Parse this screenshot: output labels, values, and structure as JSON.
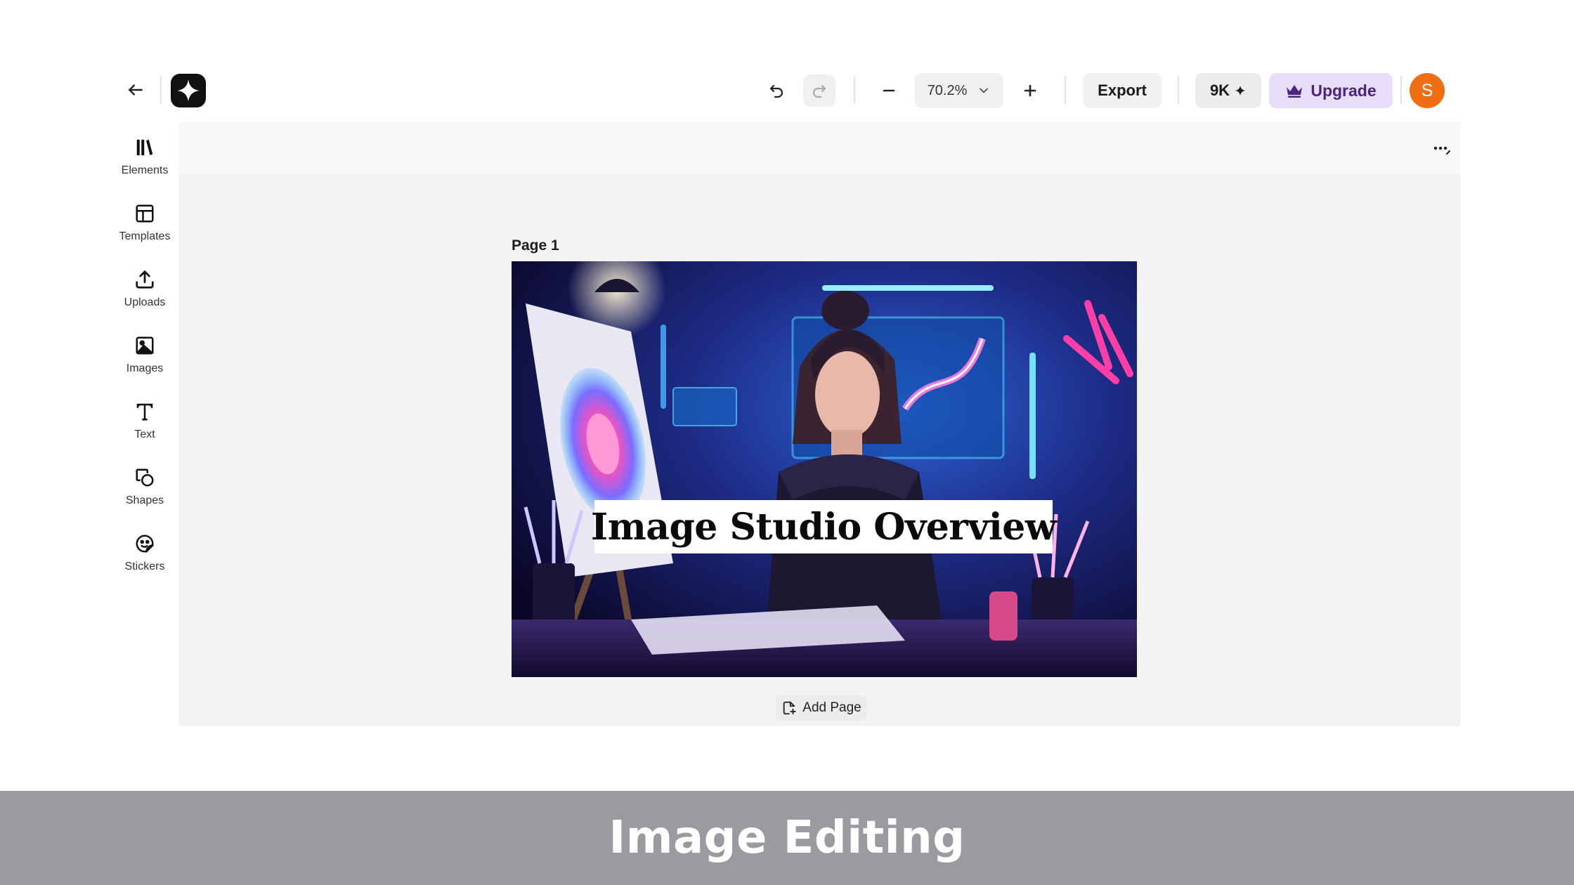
{
  "toolbar": {
    "zoom_level": "70.2%",
    "export_label": "Export",
    "credits_label": "9K",
    "upgrade_label": "Upgrade",
    "avatar_initial": "S",
    "upgrade_color": "#4a2384",
    "avatar_color": "#f06f12"
  },
  "sidebar": {
    "items": [
      {
        "label": "Elements",
        "icon": "elements-icon"
      },
      {
        "label": "Templates",
        "icon": "templates-icon"
      },
      {
        "label": "Uploads",
        "icon": "upload-icon"
      },
      {
        "label": "Images",
        "icon": "image-icon"
      },
      {
        "label": "Text",
        "icon": "text-icon"
      },
      {
        "label": "Shapes",
        "icon": "shapes-icon"
      },
      {
        "label": "Stickers",
        "icon": "sticker-icon"
      }
    ]
  },
  "editor": {
    "page_label": "Page 1",
    "canvas_title": "Image Studio Overview",
    "add_page_label": "Add Page"
  },
  "caption": {
    "text": "Image Editing"
  }
}
